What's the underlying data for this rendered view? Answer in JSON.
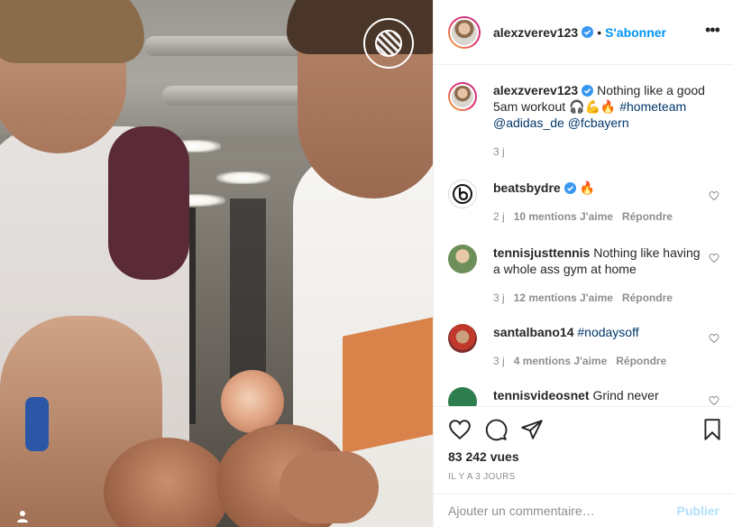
{
  "post": {
    "author": "alexzverev123",
    "separator": "•",
    "follow_label": "S'abonner",
    "more_glyph": "•••"
  },
  "caption": {
    "author": "alexzverev123",
    "text_before": " Nothing like a good 5am workout 🎧💪🔥 ",
    "hashtag": "#hometeam",
    "mention1": "@adidas_de",
    "mention2": "@fcbayern",
    "age": "3 j"
  },
  "comments": [
    {
      "user": "beatsbydre",
      "text": " 🔥",
      "age": "2 j",
      "likes": "10 mentions J'aime",
      "reply": "Répondre",
      "verified": true
    },
    {
      "user": "tennisjusttennis",
      "text": " Nothing like having a whole ass gym at home",
      "age": "3 j",
      "likes": "12 mentions J'aime",
      "reply": "Répondre",
      "verified": false
    },
    {
      "user": "santalbano14",
      "text": " ",
      "tag": "#nodaysoff",
      "age": "3 j",
      "likes": "4 mentions J'aime",
      "reply": "Répondre",
      "verified": false
    },
    {
      "user": "tennisvideosnet",
      "text": " Grind never",
      "verified": false
    }
  ],
  "stats": {
    "views": "83 242 vues",
    "posted": "IL Y A 3 JOURS"
  },
  "composer": {
    "placeholder": "Ajouter un commentaire…",
    "post_label": "Publier"
  },
  "colors": {
    "accent": "#0095f6",
    "text": "#262626",
    "muted": "#8e8e8e",
    "link": "#00376b",
    "post_disabled": "#b2dffc"
  }
}
